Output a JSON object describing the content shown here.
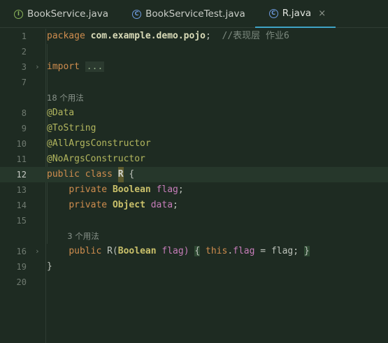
{
  "tabs": [
    {
      "label": "BookService.java",
      "icon": "interface-icon",
      "icon_glyph": "I",
      "active": false
    },
    {
      "label": "BookServiceTest.java",
      "icon": "class-icon",
      "icon_glyph": "C",
      "active": false
    },
    {
      "label": "R.java",
      "icon": "class-icon",
      "icon_glyph": "C",
      "active": true,
      "close": "×"
    }
  ],
  "line_numbers": [
    "1",
    "2",
    "3",
    "7",
    "8",
    "9",
    "10",
    "11",
    "12",
    "13",
    "14",
    "15",
    "16",
    "19",
    "20"
  ],
  "current_line": "12",
  "code": {
    "l1_package": "package",
    "l1_name": "com.example.demo.pojo",
    "l1_semi": ";",
    "l1_comment": "//表现层 作业6",
    "l3_import": "import",
    "l3_fold": "...",
    "usage_hint_class": "18 个用法",
    "l8": "@Data",
    "l9": "@ToString",
    "l10": "@AllArgsConstructor",
    "l11": "@NoArgsConstructor",
    "l12_public": "public",
    "l12_class": "class",
    "l12_name": "R",
    "l12_brace": "{",
    "l13_private": "private",
    "l13_type": "Boolean",
    "l13_field": "flag",
    "l13_semi": ";",
    "l14_private": "private",
    "l14_type": "Object",
    "l14_field": "data",
    "l14_semi": ";",
    "usage_hint_ctor": "3 个用法",
    "l16_public": "public",
    "l16_name": "R(",
    "l16_type": "Boolean",
    "l16_param": "flag)",
    "l16_open": "{",
    "l16_this": "this",
    "l16_dot": ".",
    "l16_field": "flag",
    "l16_assign": " = flag;",
    "l16_close": "}",
    "l19": "}"
  },
  "colors": {
    "background": "#1e2b22",
    "keyword": "#cf8d4e",
    "annotation": "#b2b65e",
    "field": "#c77dba",
    "type": "#c9c06a",
    "active_tab_underline": "#3fa3c6"
  }
}
